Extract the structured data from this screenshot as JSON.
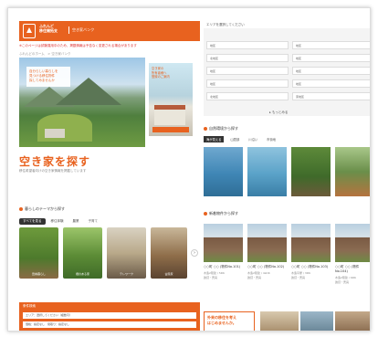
{
  "header": {
    "logo_text": "ふれんど\n移住開拓支",
    "tag": "空き家バンク"
  },
  "notice": "※このページは試験運用中のため、掲載情報は予告なく変更される場合があります",
  "breadcrumb": "ふれんどのホーム　> 空き家バンク",
  "hero": {
    "card_text": "自分らしい暮らしを\n見つける移住物件\n探してみませんか",
    "side_text": "空き家の\n所有者様へ\n登録のご案内"
  },
  "page_title": "空き家を探す",
  "page_subtitle": "移住希望者向けの空き家情報を掲載しています",
  "section_feature": "暮らしのテーマから探す",
  "feature_tabs": [
    "すべてを見る",
    "移住体験",
    "農業",
    "子育て"
  ],
  "feature_photos": [
    {
      "label": "田舎暮らし"
    },
    {
      "label": "畑のある家"
    },
    {
      "label": "テレワーク"
    },
    {
      "label": "古民家"
    }
  ],
  "search_panel": {
    "heading": "条件検索",
    "rows": [
      "エリア：選択してください（複数可）",
      "価格：指定なし　間取り：指定なし"
    ]
  },
  "form": {
    "title": "エリアを選択してください",
    "fields": [
      "地区",
      "地区",
      "北地区",
      "地区",
      "地区",
      "地区",
      "地区",
      "地区",
      "北地区",
      "東地区"
    ],
    "more": "▸ もっとみる"
  },
  "section_sea": "自然環境から探す",
  "sea_tabs": [
    "海が見える",
    "山間部",
    "川沿い",
    "市街地"
  ],
  "section_houses": "新着物件から探す",
  "houses": [
    {
      "title": "○○町 ○○ (物件No.101)",
      "sub": "木造2階建 / 5DK\n賃貸・売買"
    },
    {
      "title": "○○町 ○○ (物件No.102)",
      "sub": "木造2階建 / 4LDK\n賃貸・売買"
    },
    {
      "title": "○○町 ○○ (物件No.103)",
      "sub": "木造平屋 / 3DK\n賃貸・売買"
    },
    {
      "title": "○○町 ○○ (物件No.104)",
      "sub": "木造2階建 / 6DK\n賃貸・売買"
    }
  ],
  "banner": "外来の移住を考え\nはじめませんか。"
}
